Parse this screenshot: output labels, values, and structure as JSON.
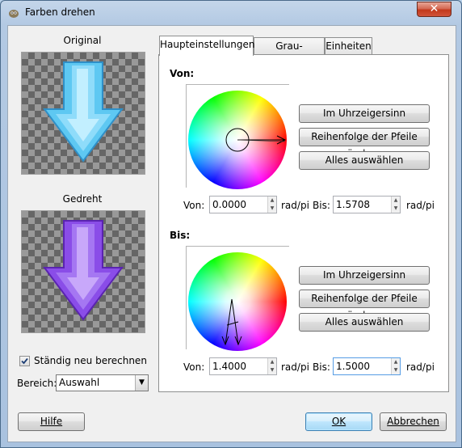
{
  "window": {
    "title": "Farben drehen",
    "close_glyph": "✕"
  },
  "preview": {
    "original_label": "Original",
    "rotated_label": "Gedreht"
  },
  "options": {
    "recompute_label": "Ständig neu berechnen",
    "recompute_checked": true,
    "range_label": "Bereich:",
    "range_value": "Auswahl"
  },
  "tabs": [
    {
      "label": "Haupteinstellungen",
      "active": true
    },
    {
      "label": "Grau-Optionen",
      "active": false
    },
    {
      "label": "Einheiten",
      "active": false
    }
  ],
  "from_section": {
    "heading": "Von:",
    "buttons": {
      "clockwise": "Im Uhrzeigersinn",
      "swap": "Reihenfolge der Pfeile ändern",
      "select_all": "Alles auswählen"
    },
    "from_label": "Von:",
    "from_value": "0.0000",
    "from_unit": "rad/pi",
    "to_label": "Bis:",
    "to_value": "1.5708",
    "to_unit": "rad/pi"
  },
  "to_section": {
    "heading": "Bis:",
    "buttons": {
      "clockwise": "Im Uhrzeigersinn",
      "swap": "Reihenfolge der Pfeile ändern",
      "select_all": "Alles auswählen"
    },
    "from_label": "Von:",
    "from_value": "1.4000",
    "from_unit": "rad/pi",
    "to_label": "Bis:",
    "to_value": "1.5000",
    "to_unit": "rad/pi"
  },
  "footer": {
    "help_label": "Hilfe",
    "ok_label": "OK",
    "cancel_label": "Abbrechen"
  },
  "colors": {
    "original_arrow": "#5ec8f2",
    "rotated_arrow": "#9a5cf0",
    "title_bar": "#b9d1ea",
    "close_button": "#c7432a"
  }
}
